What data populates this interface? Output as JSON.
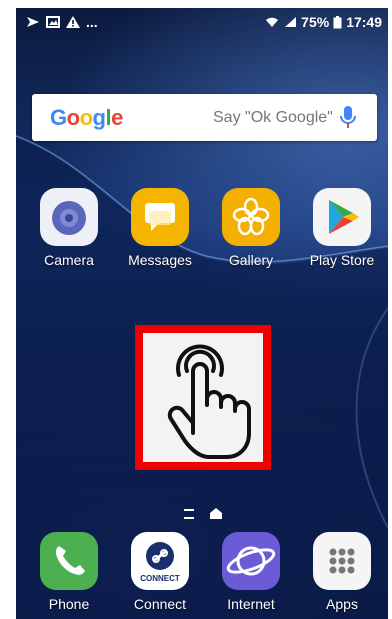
{
  "status": {
    "battery": "75%",
    "time": "17:49",
    "overflow": "..."
  },
  "search": {
    "logo": [
      "G",
      "o",
      "o",
      "g",
      "l",
      "e"
    ],
    "logo_colors": [
      "#4285F4",
      "#EA4335",
      "#FBBC05",
      "#4285F4",
      "#34A853",
      "#EA4335"
    ],
    "hint": "Say \"Ok Google\""
  },
  "apps_row": [
    {
      "label": "Camera",
      "icon": "camera-icon"
    },
    {
      "label": "Messages",
      "icon": "messages-icon"
    },
    {
      "label": "Gallery",
      "icon": "gallery-icon"
    },
    {
      "label": "Play Store",
      "icon": "play-store-icon"
    }
  ],
  "dock": [
    {
      "label": "Phone",
      "icon": "phone-icon"
    },
    {
      "label": "Connect",
      "icon": "connect-icon",
      "badge": "CONNECT"
    },
    {
      "label": "Internet",
      "icon": "internet-icon"
    },
    {
      "label": "Apps",
      "icon": "apps-grid-icon"
    }
  ],
  "overlay": {
    "icon": "tap-hand-icon",
    "border_color": "#e00000"
  },
  "colors": {
    "phone": "#4caf50",
    "messages": "#f5b400",
    "gallery": "#f4b000",
    "internet": "#6b5bd6"
  }
}
